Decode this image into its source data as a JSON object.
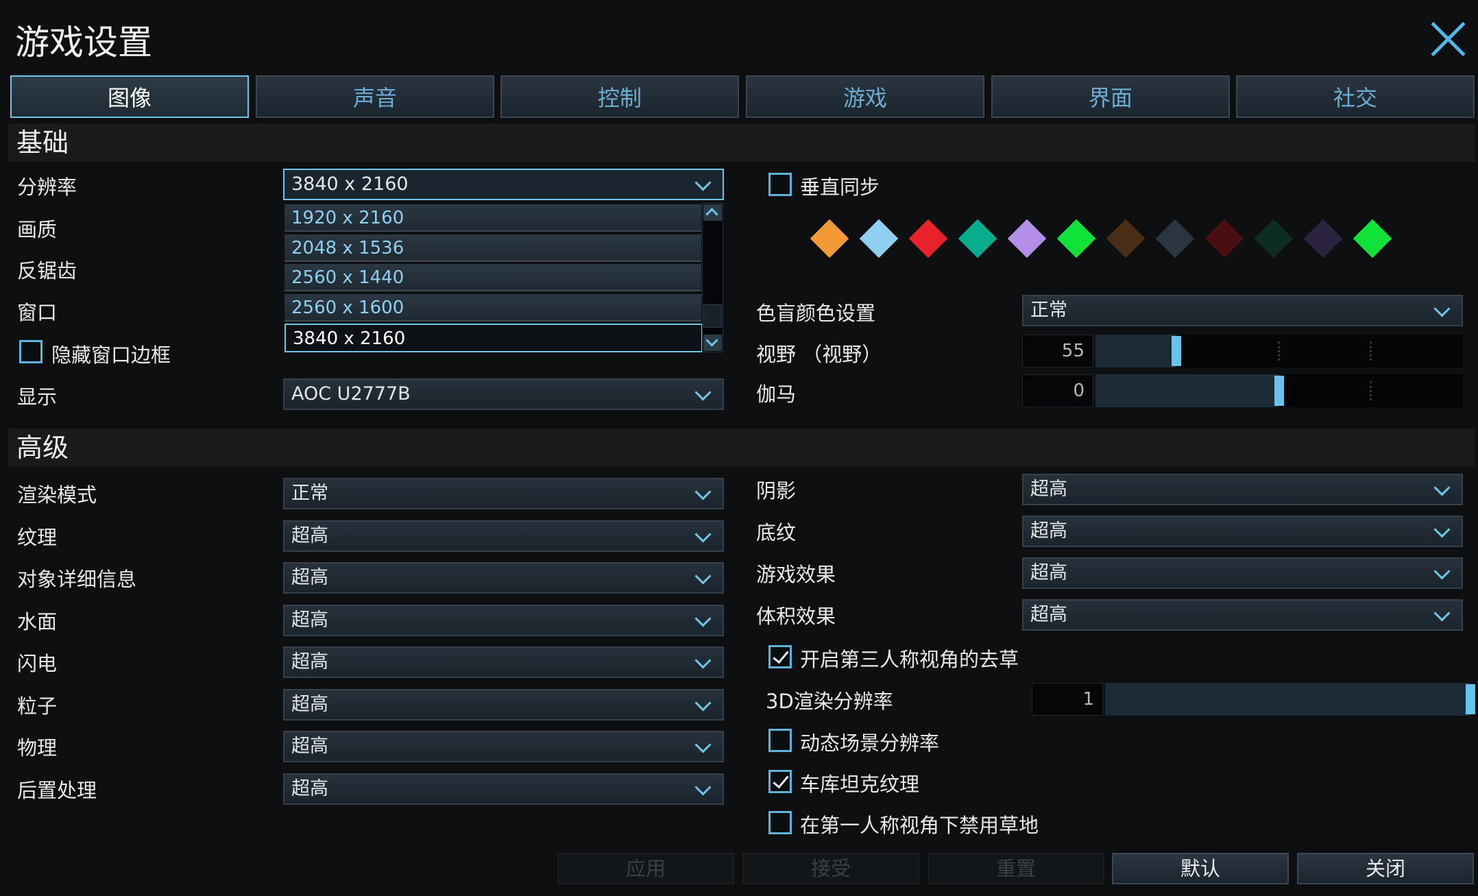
{
  "window": {
    "title": "游戏设置"
  },
  "tabs": [
    {
      "label": "图像",
      "active": true
    },
    {
      "label": "声音"
    },
    {
      "label": "控制"
    },
    {
      "label": "游戏"
    },
    {
      "label": "界面"
    },
    {
      "label": "社交"
    }
  ],
  "basic": {
    "header": "基础",
    "resolution": {
      "label": "分辨率",
      "value": "3840 x 2160",
      "options": [
        "1920 x 2160",
        "2048 x 1536",
        "2560 x 1440",
        "2560 x 1600",
        "3840 x 2160"
      ],
      "selected_option": "3840 x 2160"
    },
    "quality_label": "画质",
    "antialias_label": "反锯齿",
    "window_label": "窗口",
    "hide_border_label": "隐藏窗口边框",
    "hide_border_checked": false,
    "display": {
      "label": "显示",
      "value": "AOC U2777B"
    },
    "vsync_label": "垂直同步",
    "vsync_checked": false,
    "colorblind_swatches": [
      "#f39a36",
      "#8ecff2",
      "#e8212a",
      "#08ad8e",
      "#b48ee8",
      "#10e23a",
      "#4a2e17",
      "#2a3540",
      "#4a0e10",
      "#0d2c24",
      "#2c2340",
      "#10e23a"
    ],
    "colorblind": {
      "label": "色盲颜色设置",
      "value": "正常"
    },
    "fov": {
      "label": "视野 （视野）",
      "value": "55",
      "fraction": 0.22
    },
    "gamma": {
      "label": "伽马",
      "value": "0",
      "fraction": 0.5
    }
  },
  "advanced": {
    "header": "高级",
    "left": [
      {
        "label": "渲染模式",
        "value": "正常"
      },
      {
        "label": "纹理",
        "value": "超高"
      },
      {
        "label": "对象详细信息",
        "value": "超高"
      },
      {
        "label": "水面",
        "value": "超高"
      },
      {
        "label": "闪电",
        "value": "超高"
      },
      {
        "label": "粒子",
        "value": "超高"
      },
      {
        "label": "物理",
        "value": "超高"
      },
      {
        "label": "后置处理",
        "value": "超高"
      }
    ],
    "right": [
      {
        "label": "阴影",
        "value": "超高"
      },
      {
        "label": "底纹",
        "value": "超高"
      },
      {
        "label": "游戏效果",
        "value": "超高"
      },
      {
        "label": "体积效果",
        "value": "超高"
      }
    ],
    "grass_third_person": {
      "label": "开启第三人称视角的去草",
      "checked": true
    },
    "render3d": {
      "label": "3D渲染分辨率",
      "value": "1",
      "fraction": 1.0
    },
    "dynamic_res": {
      "label": "动态场景分辨率",
      "checked": false
    },
    "garage_texture": {
      "label": "车库坦克纹理",
      "checked": true
    },
    "grass_first_person": {
      "label": "在第一人称视角下禁用草地",
      "checked": false
    }
  },
  "footer": {
    "apply": "应用",
    "accept": "接受",
    "reset": "重置",
    "default": "默认",
    "close": "关闭"
  }
}
